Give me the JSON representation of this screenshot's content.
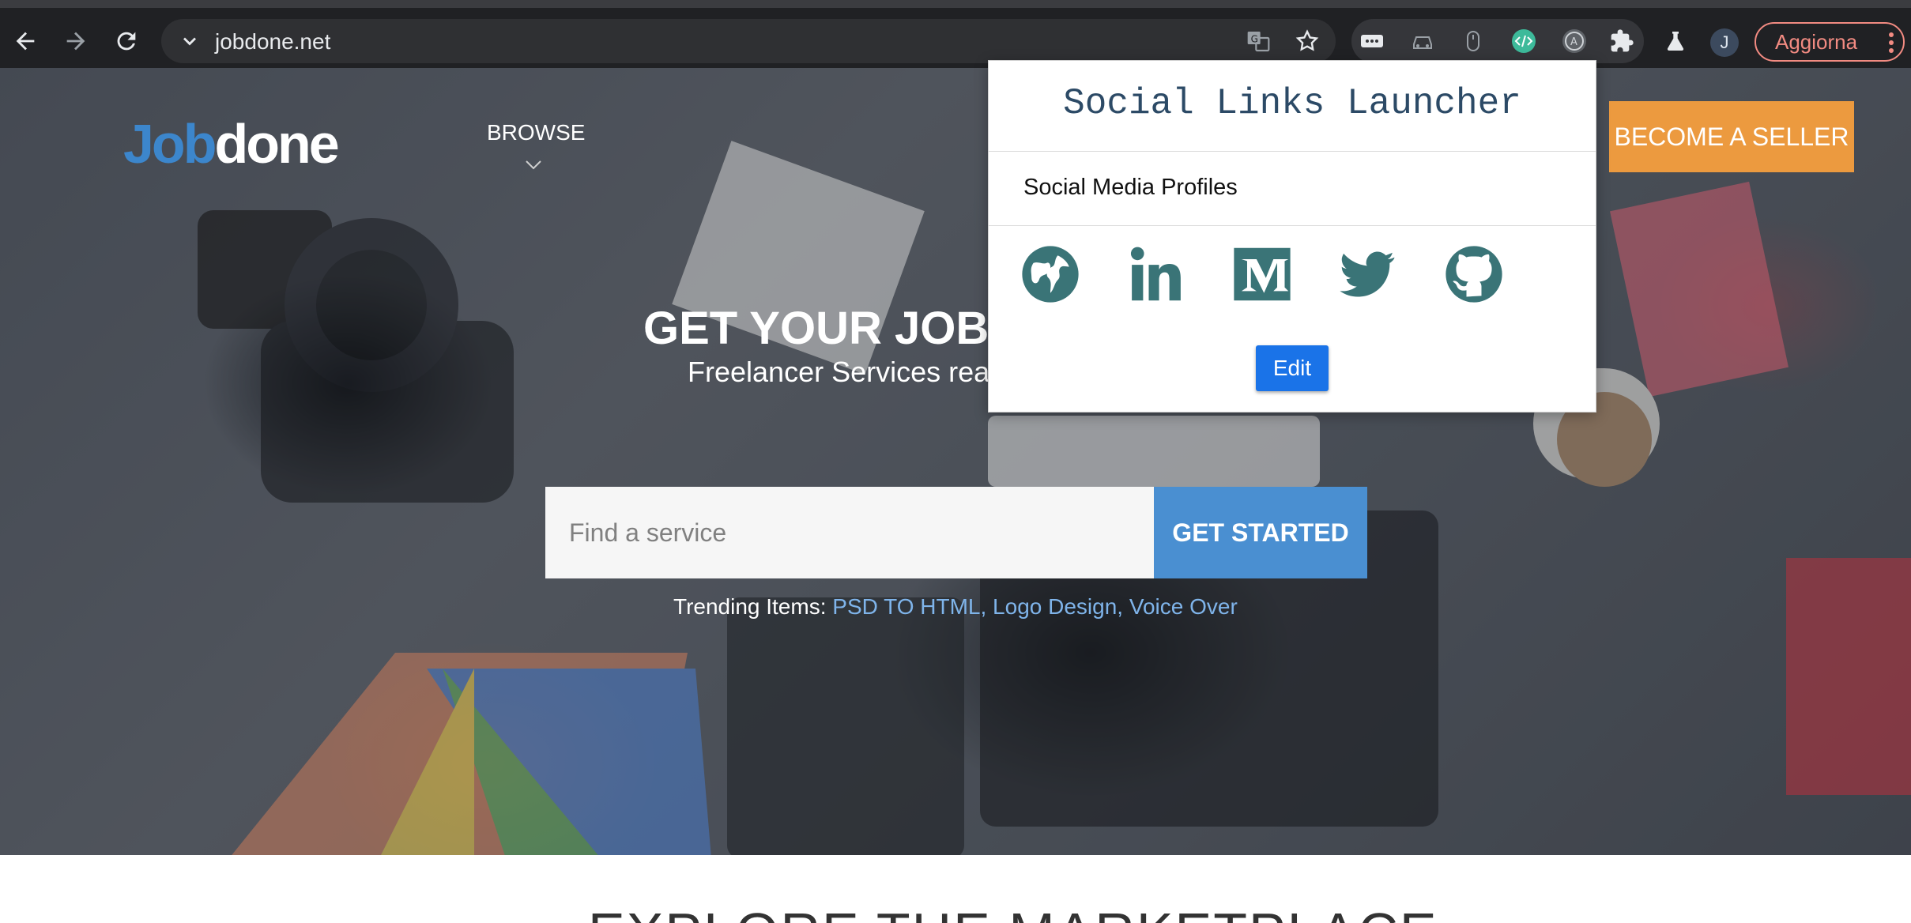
{
  "browser": {
    "url": "jobdone.net",
    "avatar_initial": "J",
    "update_label": "Aggiorna"
  },
  "site": {
    "logo_part1": "Job",
    "logo_part2": "done",
    "nav_browse": "BROWSE",
    "seller_button": "BECOME A SELLER",
    "headline": "GET YOUR JOB",
    "subline": "Freelancer Services rea",
    "search_placeholder": "Find a service",
    "search_button": "GET STARTED",
    "trending_label": "Trending Items:",
    "trending_items": "PSD TO HTML, Logo Design, Voice Over",
    "explore_title": "EXPLORE THE MARKETPLACE"
  },
  "popup": {
    "title": "Social Links Launcher",
    "subtitle": "Social Media Profiles",
    "icons": [
      "globe-icon",
      "linkedin-icon",
      "medium-icon",
      "twitter-icon",
      "github-icon"
    ],
    "icon_color": "#3a7477",
    "edit_label": "Edit"
  },
  "colors": {
    "accent_blue": "#4a8fd1",
    "seller_orange": "#ec9a3f",
    "edit_blue": "#1a73e8",
    "update_red": "#f28b82"
  }
}
